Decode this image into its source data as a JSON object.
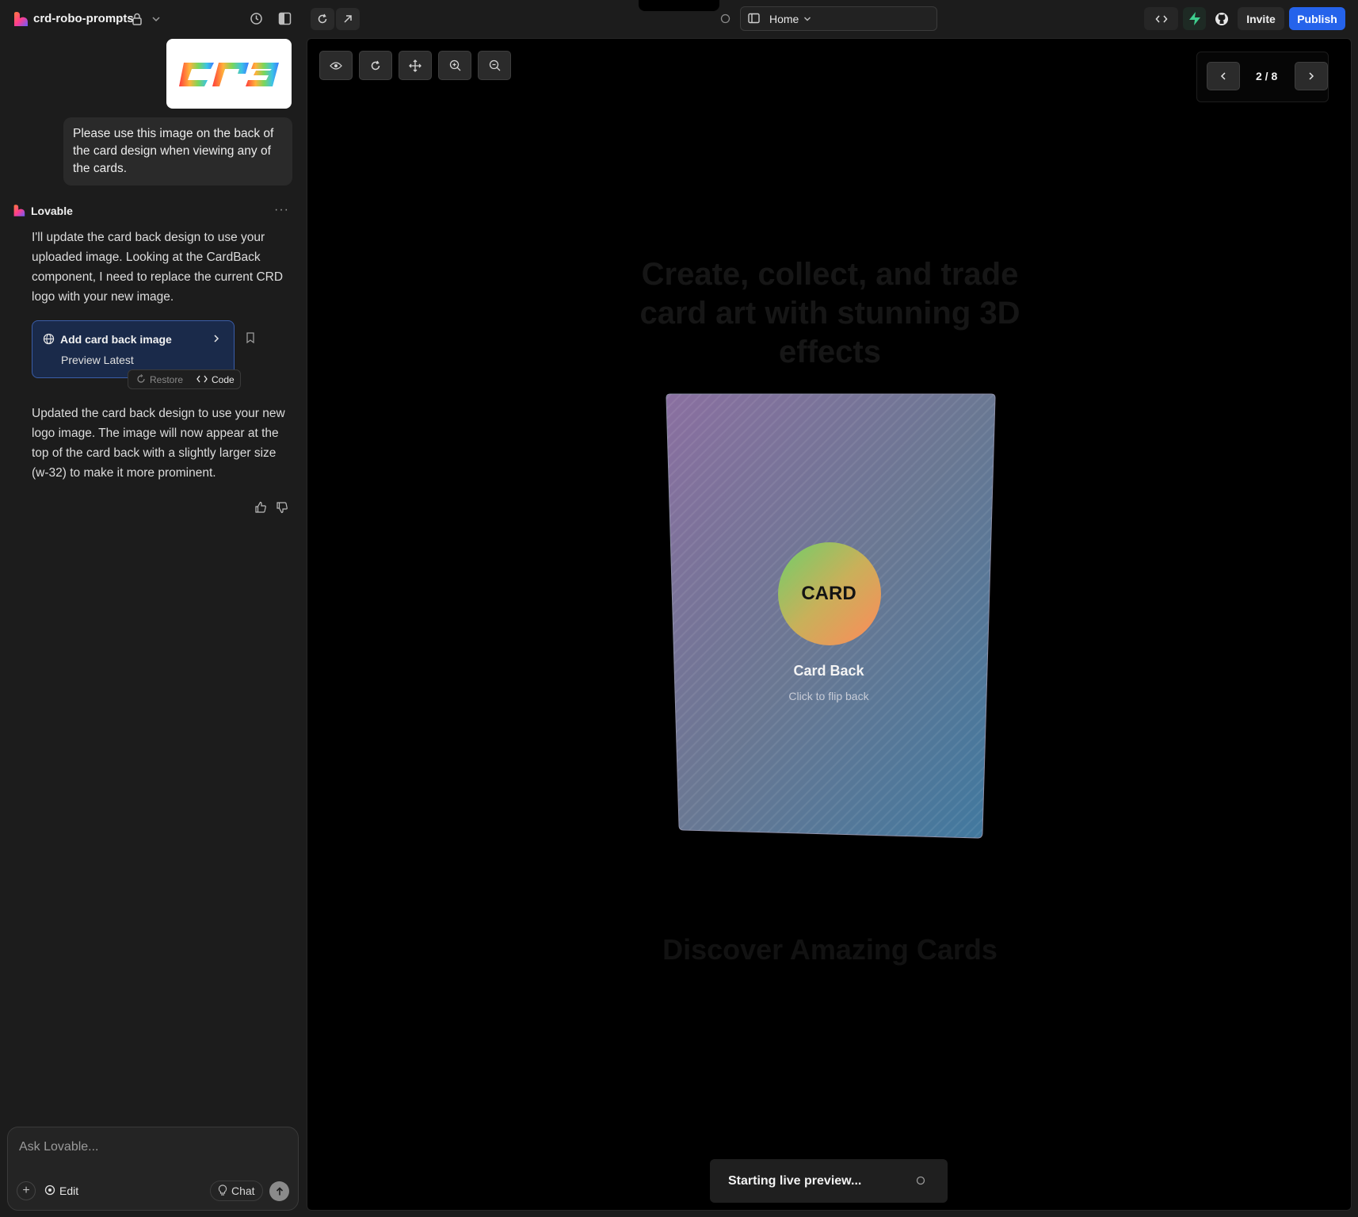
{
  "topbar": {
    "project_name": "crd-robo-prompts",
    "url_path": "Home",
    "invite_label": "Invite",
    "publish_label": "Publish"
  },
  "chat": {
    "uploaded_image_text": "CRD",
    "user_message": "Please use this image on the back of the card design when viewing any of the cards.",
    "assistant_name": "Lovable",
    "assistant_message_1": "I'll update the card back design to use your uploaded image. Looking at the CardBack component, I need to replace the current CRD logo with your new image.",
    "action_card": {
      "title": "Add card back image",
      "subtitle": "Preview Latest",
      "restore_label": "Restore",
      "code_label": "Code"
    },
    "assistant_message_2": "Updated the card back design to use your new logo image. The image will now appear at the top of the card back with a slightly larger size (w-32) to make it more prominent."
  },
  "input": {
    "placeholder": "Ask Lovable...",
    "edit_label": "Edit",
    "chat_label": "Chat"
  },
  "preview": {
    "pager_text": "2 / 8",
    "background_heading": "Create, collect, and trade card art with stunning 3D effects",
    "background_subheading": "Discover Amazing Cards",
    "card": {
      "circle_label": "CARD",
      "title": "Card Back",
      "hint": "Click to flip back"
    },
    "toast_text": "Starting live preview..."
  },
  "colors": {
    "accent": "#2563eb",
    "sidebar_bg": "#1c1c1c",
    "preview_bg": "#000000",
    "action_card_border": "#3a5da8"
  }
}
